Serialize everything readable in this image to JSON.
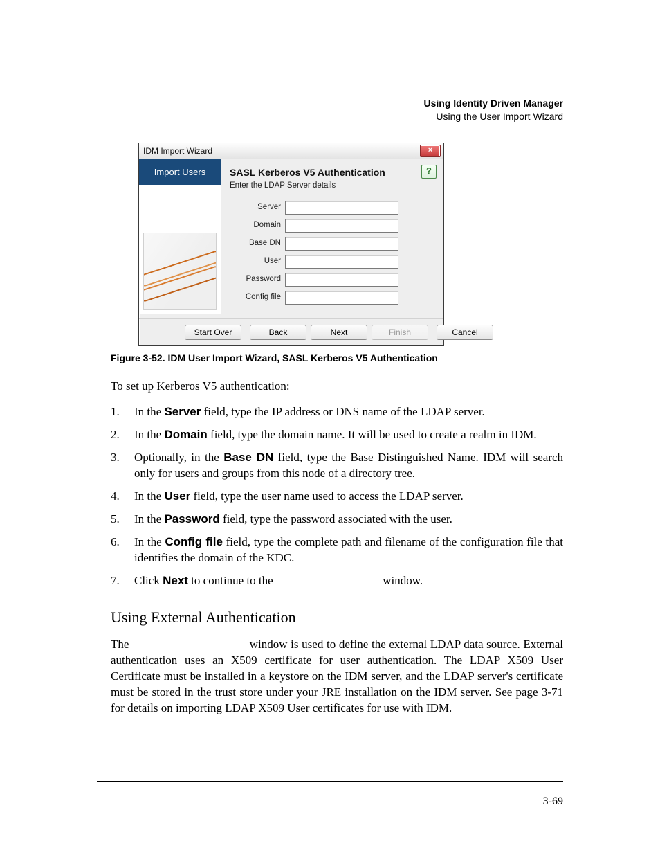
{
  "runhead": {
    "line1": "Using Identity Driven Manager",
    "line2": "Using the User Import Wizard"
  },
  "window": {
    "title": "IDM Import Wizard",
    "close_label": "×",
    "side_title": "Import Users",
    "heading": "SASL Kerberos V5 Authentication",
    "help_label": "?",
    "subtitle": "Enter the LDAP Server details",
    "fields": {
      "server": "Server",
      "domain": "Domain",
      "basedn": "Base DN",
      "user": "User",
      "password": "Password",
      "config": "Config file"
    },
    "buttons": {
      "start_over": "Start Over",
      "back": "Back",
      "next": "Next",
      "finish": "Finish",
      "cancel": "Cancel"
    }
  },
  "figcap": "Figure 3-52. IDM User Import Wizard, SASL Kerberos V5 Authentication",
  "intro": "To set up Kerberos V5 authentication:",
  "steps": [
    {
      "n": "1.",
      "pre": "In the ",
      "bold": "Server",
      "post": " field, type the IP address or DNS name of the LDAP server."
    },
    {
      "n": "2.",
      "pre": "In the ",
      "bold": "Domain",
      "post": " field, type the domain name. It will be used to create a realm in IDM."
    },
    {
      "n": "3.",
      "pre": "Optionally, in the ",
      "bold": "Base DN",
      "post": " field, type the Base Distinguished Name. IDM will search only for users and groups from this node of a directory tree."
    },
    {
      "n": "4.",
      "pre": "In the ",
      "bold": "User",
      "post": " field, type the user name used to access the LDAP server."
    },
    {
      "n": "5.",
      "pre": "In the ",
      "bold": "Password",
      "post": " field, type the password associated with the user."
    },
    {
      "n": "6.",
      "pre": "In the ",
      "bold": "Config file",
      "post": " field, type the complete path and filename of the configuration file that identifies the domain of the KDC."
    },
    {
      "n": "7.",
      "pre": "Click ",
      "bold": "Next",
      "post": " to continue to the ",
      "tail": " window."
    }
  ],
  "section": {
    "title": "Using External Authentication",
    "para_lead": "The ",
    "para_rest": " window is used to define the external LDAP data source. External authentication uses an X509 certificate for user authentication. The LDAP X509 User Certificate must be installed in a keystore on the IDM server, and the LDAP server's certificate must be stored in the trust store under your JRE installation on the IDM server. See page 3-71 for details on importing LDAP X509 User certificates for use with IDM."
  },
  "page_number": "3-69"
}
